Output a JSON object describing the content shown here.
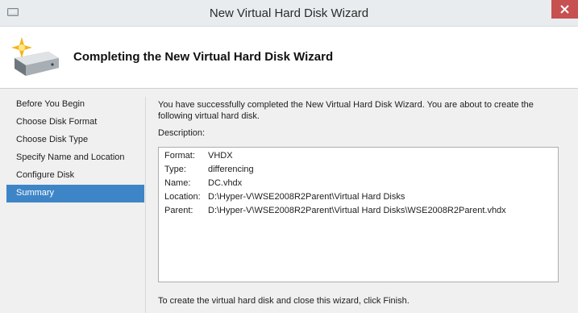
{
  "window": {
    "title": "New Virtual Hard Disk Wizard"
  },
  "header": {
    "title": "Completing the New Virtual Hard Disk Wizard",
    "icon": "hard-disk-new-icon"
  },
  "nav": {
    "items": [
      {
        "label": "Before You Begin",
        "active": false
      },
      {
        "label": "Choose Disk Format",
        "active": false
      },
      {
        "label": "Choose Disk Type",
        "active": false
      },
      {
        "label": "Specify Name and Location",
        "active": false
      },
      {
        "label": "Configure Disk",
        "active": false
      },
      {
        "label": "Summary",
        "active": true
      }
    ]
  },
  "main": {
    "intro_line1": "You have successfully completed the New Virtual Hard Disk Wizard. You are about to create the",
    "intro_line2": "following virtual hard disk.",
    "description_label": "Description:",
    "description": [
      {
        "key": "Format:",
        "value": "VHDX"
      },
      {
        "key": "Type:",
        "value": "differencing"
      },
      {
        "key": "Name:",
        "value": "DC.vhdx"
      },
      {
        "key": "Location:",
        "value": "D:\\Hyper-V\\WSE2008R2Parent\\Virtual Hard Disks"
      },
      {
        "key": "Parent:",
        "value": "D:\\Hyper-V\\WSE2008R2Parent\\Virtual Hard Disks\\WSE2008R2Parent.vhdx"
      }
    ],
    "finish_text": "To create the virtual hard disk and close this wizard, click Finish."
  },
  "colors": {
    "selection": "#3e85c7",
    "close_button": "#c75050"
  }
}
